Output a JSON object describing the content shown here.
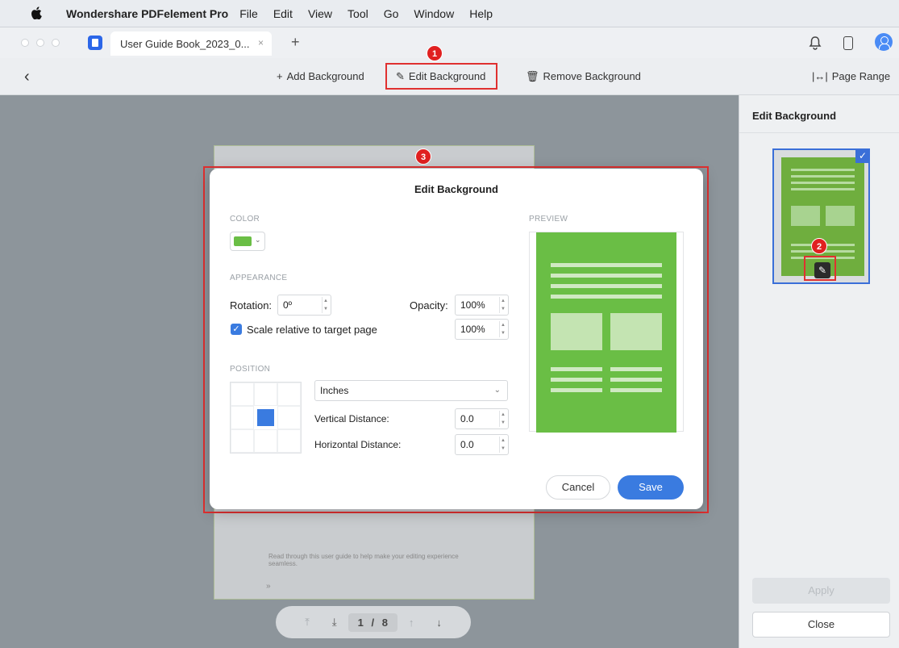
{
  "menubar": {
    "app_name": "Wondershare PDFelement Pro",
    "items": [
      "File",
      "Edit",
      "View",
      "Tool",
      "Go",
      "Window",
      "Help"
    ]
  },
  "titlebar": {
    "tab_title": "User Guide Book_2023_0...",
    "tab_close": "×",
    "new_tab": "+"
  },
  "toolbar": {
    "back": "‹",
    "add_background": "Add Background",
    "edit_background": "Edit Background",
    "remove_background": "Remove Background",
    "page_range": "Page Range"
  },
  "annotations": {
    "step1": "1",
    "step2": "2",
    "step3": "3"
  },
  "document": {
    "body_text": "Read through this user guide to help make your editing experience seamless.",
    "chevron": "»"
  },
  "pager": {
    "first": "⤒",
    "prev": "⤓",
    "current": "1",
    "separator": "/",
    "total": "8",
    "up": "↑",
    "down": "↓"
  },
  "right_panel": {
    "title": "Edit Background",
    "apply": "Apply",
    "close": "Close"
  },
  "dialog": {
    "title": "Edit Background",
    "color_section": "COLOR",
    "color_value": "#6abe45",
    "appearance_section": "APPEARANCE",
    "rotation_label": "Rotation:",
    "rotation_value": "0º",
    "opacity_label": "Opacity:",
    "opacity_value": "100%",
    "scale_label": "Scale relative to target page",
    "scale_checked": true,
    "scale_value": "100%",
    "position_section": "POSITION",
    "units": "Inches",
    "vertical_label": "Vertical Distance:",
    "vertical_value": "0.0",
    "horizontal_label": "Horizontal Distance:",
    "horizontal_value": "0.0",
    "preview_section": "PREVIEW",
    "cancel": "Cancel",
    "save": "Save"
  },
  "colors": {
    "accent": "#3a7be0",
    "highlight": "#e03030",
    "background_green": "#6abe45"
  }
}
